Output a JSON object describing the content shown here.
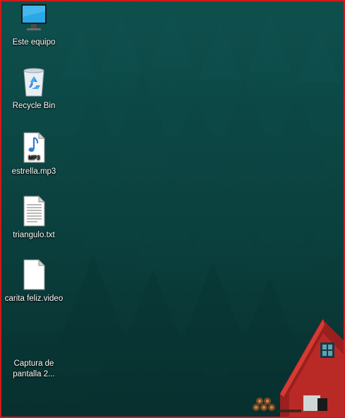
{
  "desktop": {
    "accent_border_color": "#d01a1a",
    "icons": [
      {
        "label": "Este equipo",
        "icon": "monitor-icon"
      },
      {
        "label": "Recycle Bin",
        "icon": "recycle-bin-icon"
      },
      {
        "label": "estrella.mp3",
        "icon": "mp3-file-icon",
        "badge": "MP3"
      },
      {
        "label": "triangulo.txt",
        "icon": "text-file-icon"
      },
      {
        "label": "carita feliz.video",
        "icon": "blank-file-icon"
      },
      {
        "label": "Captura de pantalla 2...",
        "icon": "screenshot-file-icon"
      }
    ]
  }
}
